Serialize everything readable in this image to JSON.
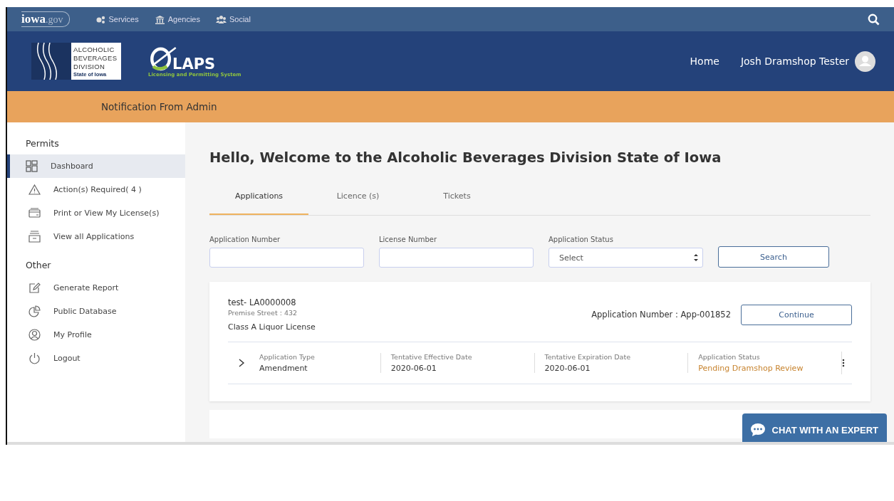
{
  "topbar": {
    "logo_main": "iowa",
    "logo_suffix": ".gov",
    "links": [
      {
        "label": "Services"
      },
      {
        "label": "Agencies"
      },
      {
        "label": "Social"
      }
    ]
  },
  "header": {
    "abd_logo": [
      "ALCOHOLIC",
      "BEVERAGES",
      "DIVISION"
    ],
    "abd_logo_state": "State of Iowa",
    "laps_logo": "LAPS",
    "laps_tagline": "Licensing and Permitting System",
    "nav": [
      "Home"
    ],
    "user": "Josh Dramshop Tester"
  },
  "notification": "Notification From Admin",
  "sidebar": {
    "sections": [
      {
        "title": "Permits",
        "items": [
          {
            "label": "Dashboard",
            "selected": true
          },
          {
            "label": "Action(s) Required( 4 )",
            "selected": false
          },
          {
            "label": "Print or View My License(s)",
            "selected": false
          },
          {
            "label": "View all Applications",
            "selected": false
          }
        ]
      },
      {
        "title": "Other",
        "items": [
          {
            "label": "Generate Report",
            "selected": false
          },
          {
            "label": "Public Database",
            "selected": false
          },
          {
            "label": "My Profile",
            "selected": false
          },
          {
            "label": "Logout",
            "selected": false
          }
        ]
      }
    ]
  },
  "main": {
    "title": "Hello, Welcome to the Alcoholic Beverages Division State of Iowa",
    "tabs": [
      {
        "label": "Applications",
        "selected": true
      },
      {
        "label": "Licence (s)",
        "selected": false
      },
      {
        "label": "Tickets",
        "selected": false
      }
    ],
    "filters": [
      {
        "label": "Application Number",
        "kind": "text"
      },
      {
        "label": "License Number",
        "kind": "text"
      },
      {
        "label": "Application Status",
        "kind": "select",
        "value": "Select"
      }
    ],
    "search_button": "Search",
    "cards": [
      {
        "name": "test- LA0000008",
        "street": "Premise Street : 432",
        "license_class": "Class A Liquor License",
        "app_number": "Application Number : App-001852",
        "button": "Continue",
        "details": [
          {
            "label": "Application Type",
            "value": "Amendment",
            "kind": "plain"
          },
          {
            "label": "Tentative Effective Date",
            "value": "2020-06-01",
            "kind": "plain"
          },
          {
            "label": "Tentative Expiration Date",
            "value": "2020-06-01",
            "kind": "plain"
          },
          {
            "label": "Application Status",
            "value": "Pending Dramshop Review",
            "kind": "status"
          }
        ]
      }
    ]
  },
  "chat_button": "CHAT WITH AN EXPERT"
}
